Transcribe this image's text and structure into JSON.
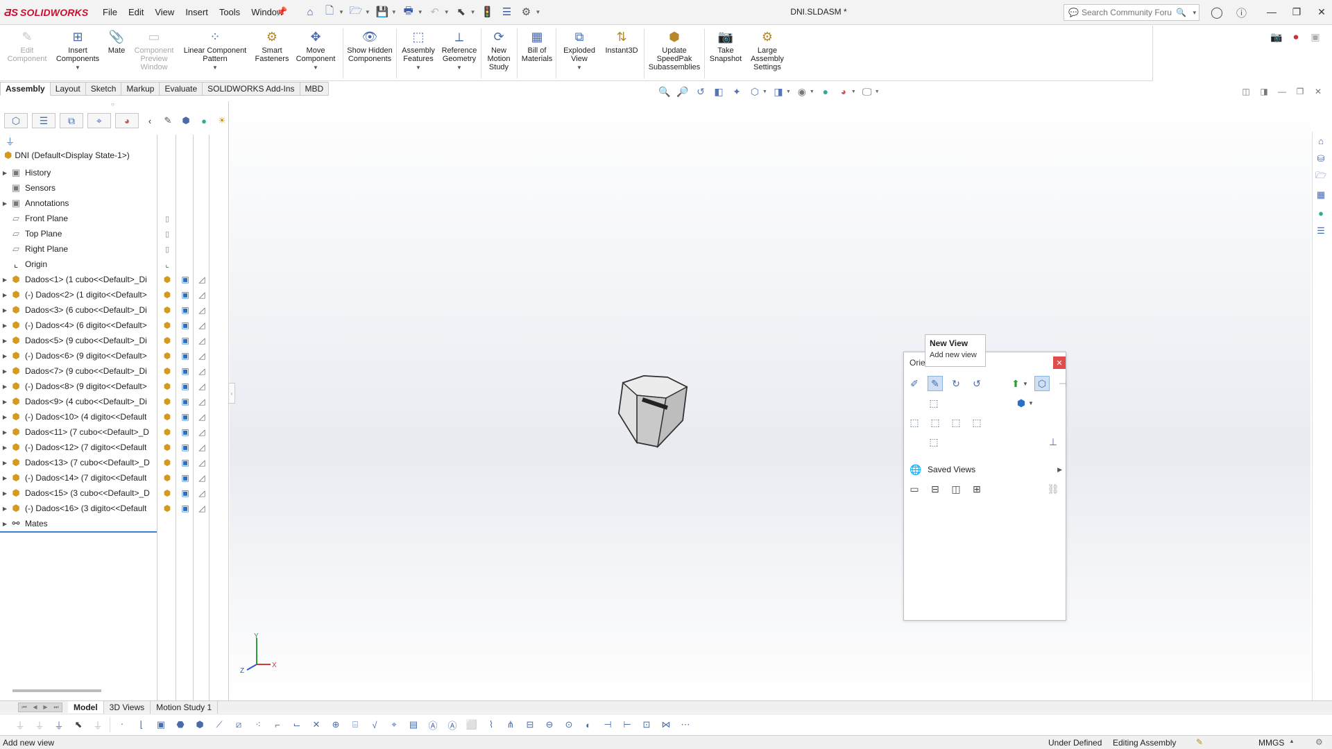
{
  "app": {
    "brand": "SOLIDWORKS",
    "doc_title": "DNI.SLDASM *",
    "menu": [
      "File",
      "Edit",
      "View",
      "Insert",
      "Tools",
      "Window"
    ],
    "search_placeholder": "Search Community Forum"
  },
  "ribbon": {
    "edit_component": "Edit Component",
    "insert_components": "Insert Components",
    "mate": "Mate",
    "component_preview": "Component Preview Window",
    "linear_pattern": "Linear Component Pattern",
    "smart_fasteners": "Smart Fasteners",
    "move_component": "Move Component",
    "show_hidden": "Show Hidden Components",
    "assembly_features": "Assembly Features",
    "reference_geometry": "Reference Geometry",
    "new_motion_study": "New Motion Study",
    "bill_of_materials": "Bill of Materials",
    "exploded_view": "Exploded View",
    "instant3d": "Instant3D",
    "update_speedpak": "Update SpeedPak Subassemblies",
    "take_snapshot": "Take Snapshot",
    "large_assembly": "Large Assembly Settings"
  },
  "command_tabs": [
    "Assembly",
    "Layout",
    "Sketch",
    "Markup",
    "Evaluate",
    "SOLIDWORKS Add-Ins",
    "MBD"
  ],
  "tree": {
    "root": "DNI  (Default<Display State-1>)",
    "items": [
      {
        "label": "History",
        "type": "folder",
        "expand": true
      },
      {
        "label": "Sensors",
        "type": "folder",
        "expand": false
      },
      {
        "label": "Annotations",
        "type": "folder",
        "expand": true
      },
      {
        "label": "Front Plane",
        "type": "plane",
        "expand": false
      },
      {
        "label": "Top Plane",
        "type": "plane",
        "expand": false
      },
      {
        "label": "Right Plane",
        "type": "plane",
        "expand": false
      },
      {
        "label": "Origin",
        "type": "origin",
        "expand": false
      },
      {
        "label": "Dados<1> (1 cubo<<Default>_Di",
        "type": "comp",
        "expand": true
      },
      {
        "label": "(-) Dados<2> (1 digito<<Default>",
        "type": "comp",
        "expand": true
      },
      {
        "label": "Dados<3> (6 cubo<<Default>_Di",
        "type": "comp",
        "expand": true
      },
      {
        "label": "(-) Dados<4> (6 digito<<Default>",
        "type": "comp",
        "expand": true
      },
      {
        "label": "Dados<5> (9 cubo<<Default>_Di",
        "type": "comp",
        "expand": true
      },
      {
        "label": "(-) Dados<6> (9 digito<<Default>",
        "type": "comp",
        "expand": true
      },
      {
        "label": "Dados<7> (9 cubo<<Default>_Di",
        "type": "comp",
        "expand": true
      },
      {
        "label": "(-) Dados<8> (9 digito<<Default>",
        "type": "comp",
        "expand": true
      },
      {
        "label": "Dados<9> (4 cubo<<Default>_Di",
        "type": "comp",
        "expand": true
      },
      {
        "label": "(-) Dados<10> (4 digito<<Default",
        "type": "comp",
        "expand": true
      },
      {
        "label": "Dados<11> (7 cubo<<Default>_D",
        "type": "comp",
        "expand": true
      },
      {
        "label": "(-) Dados<12> (7 digito<<Default",
        "type": "comp",
        "expand": true
      },
      {
        "label": "Dados<13> (7 cubo<<Default>_D",
        "type": "comp",
        "expand": true
      },
      {
        "label": "(-) Dados<14> (7 digito<<Default",
        "type": "comp",
        "expand": true
      },
      {
        "label": "Dados<15> (3 cubo<<Default>_D",
        "type": "comp",
        "expand": true
      },
      {
        "label": "(-) Dados<16> (3 digito<<Default",
        "type": "comp",
        "expand": true
      },
      {
        "label": "Mates",
        "type": "mates",
        "expand": true
      }
    ]
  },
  "orientation": {
    "title": "Orie",
    "saved_views": "Saved Views"
  },
  "tooltip": {
    "title": "New View",
    "desc": "Add new view"
  },
  "bottom_tabs": [
    "Model",
    "3D Views",
    "Motion Study 1"
  ],
  "status": {
    "text": "Add new view",
    "defined": "Under Defined",
    "mode": "Editing Assembly",
    "units": "MMGS"
  },
  "triad": {
    "x": "X",
    "y": "Y",
    "z": "Z"
  },
  "colors": {
    "brand": "#c8102e",
    "accent": "#2a6fc5",
    "component": "#d49a1e",
    "close": "#e04b4b"
  }
}
